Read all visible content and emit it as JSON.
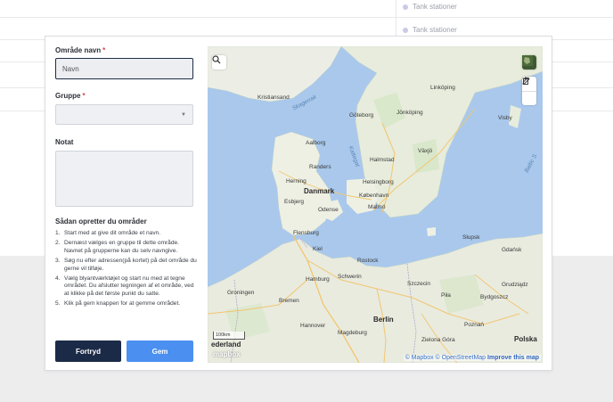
{
  "background": {
    "list_items": [
      "Tank stationer",
      "Tank stationer"
    ]
  },
  "form": {
    "name_label": "Område navn",
    "name_required": "*",
    "name_value": "Navn",
    "group_label": "Gruppe",
    "group_required": "*",
    "group_value": "",
    "notes_label": "Notat",
    "notes_value": ""
  },
  "instructions": {
    "title": "Sådan opretter du områder",
    "steps": [
      {
        "num": "1.",
        "text": "Start med at give dit område et navn."
      },
      {
        "num": "2.",
        "text": "Dernæst vælges en gruppe til dette område. Navnet på grupperne kan du selv navngive."
      },
      {
        "num": "3.",
        "text": "Søg nu efter adressen(på kortet) på det område du gerne vil tilføje."
      },
      {
        "num": "4.",
        "text": "Vælg blyantværktøjet og start nu med at tegne området. Du afslutter tegningen af et område, ved at klikke på det første punkt du satte."
      },
      {
        "num": "5.",
        "text": "Klik på gem knappen for at gemme området."
      }
    ]
  },
  "buttons": {
    "cancel": "Fortryd",
    "save": "Gem"
  },
  "map": {
    "labels": {
      "kristiansand": "Kristiansand",
      "skagerrak": "Skagerrak",
      "goteborg": "Göteborg",
      "jonkoping": "Jönköping",
      "linkoping": "Linköping",
      "visby": "Visby",
      "aalborg": "Aalborg",
      "kattegat": "Kattegat",
      "halmstad": "Halmstad",
      "vaxjo": "Växjö",
      "randers": "Randers",
      "herning": "Herning",
      "danmark": "Danmark",
      "kobenhavn": "København",
      "helsingborg": "Helsingborg",
      "esbjerg": "Esbjerg",
      "odense": "Odense",
      "malmo": "Malmö",
      "baltic": "Baltic S",
      "flensburg": "Flensburg",
      "kiel": "Kiel",
      "rostock": "Rostock",
      "gdansk": "Gdańsk",
      "slupsk": "Słupsk",
      "hamburg": "Hamburg",
      "schwerin": "Schwerin",
      "szczecin": "Szczecin",
      "groningen": "Groningen",
      "bremen": "Bremen",
      "grudziadz": "Grudziądz",
      "pila": "Piła",
      "bydgoszcz": "Bydgoszcz",
      "hannover": "Hannover",
      "berlin": "Berlin",
      "poznan": "Poznań",
      "magdeburg": "Magdeburg",
      "zielona_gora": "Zielona Góra",
      "nederland": "ederland",
      "polska": "Polska"
    },
    "scale": "100km",
    "logo": "mapbox",
    "attribution_mapbox": "© Mapbox",
    "attribution_osm": "© OpenStreetMap",
    "attribution_improve": "Improve this map"
  },
  "icons": {
    "search": "search-icon",
    "pencil": "pencil-icon",
    "trash": "trash-icon",
    "layers": "satellite-layer-icon"
  }
}
